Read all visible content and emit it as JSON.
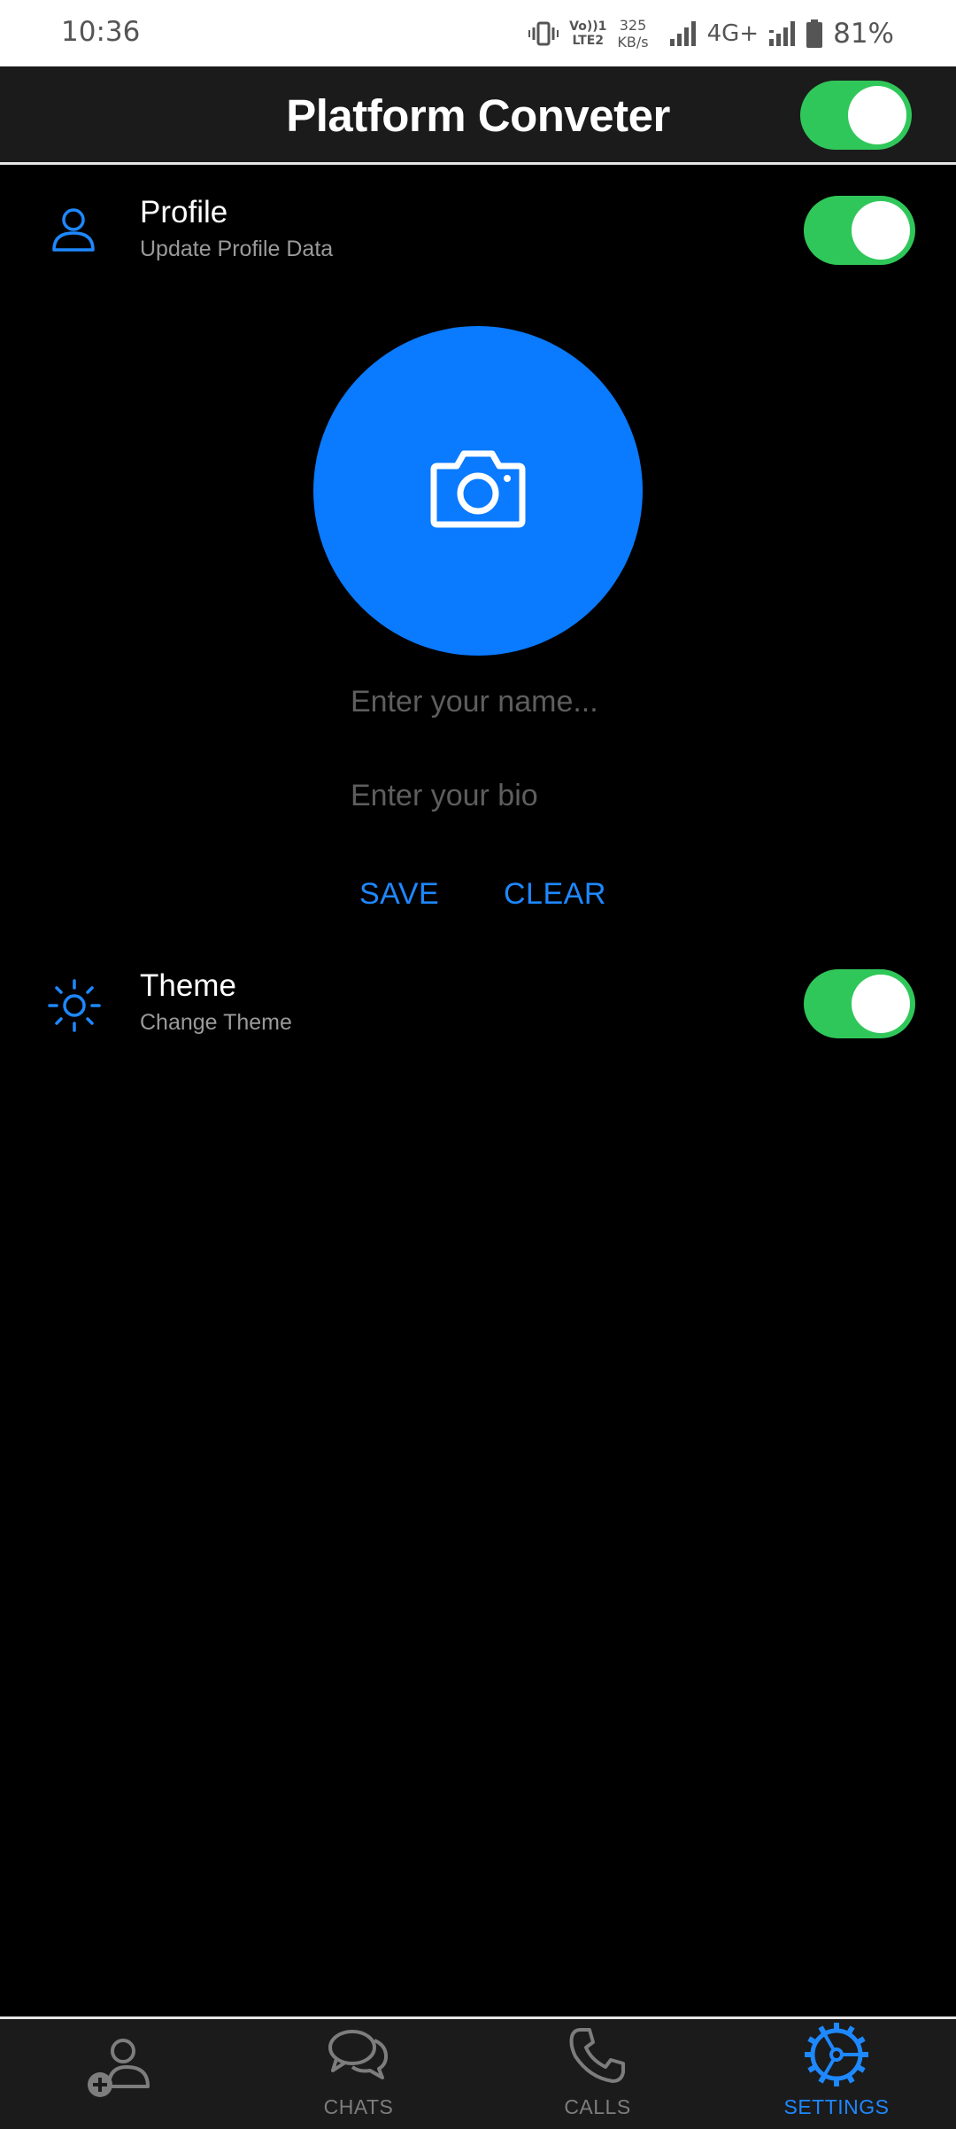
{
  "status_bar": {
    "time": "10:36",
    "volte_line1": "Vo))1",
    "volte_line2": "LTE2",
    "speed_value": "325",
    "speed_unit": "KB/s",
    "network": "4G+",
    "battery": "81%"
  },
  "app_bar": {
    "title": "Platform Conveter",
    "toggle_on": true
  },
  "profile_section": {
    "title": "Profile",
    "subtitle": "Update Profile Data",
    "toggle_on": true,
    "name_placeholder": "Enter your name...",
    "bio_placeholder": "Enter your bio",
    "save_label": "SAVE",
    "clear_label": "CLEAR"
  },
  "theme_section": {
    "title": "Theme",
    "subtitle": "Change Theme",
    "toggle_on": true
  },
  "bottom_nav": {
    "items": [
      {
        "label": "",
        "icon": "add-contact-icon",
        "active": false
      },
      {
        "label": "CHATS",
        "icon": "chats-icon",
        "active": false
      },
      {
        "label": "CALLS",
        "icon": "phone-icon",
        "active": false
      },
      {
        "label": "SETTINGS",
        "icon": "settings-icon",
        "active": true
      }
    ]
  },
  "colors": {
    "accent": "#0a7aff",
    "toggle": "#30c75a",
    "background": "#000000",
    "bar": "#1b1b1b"
  }
}
